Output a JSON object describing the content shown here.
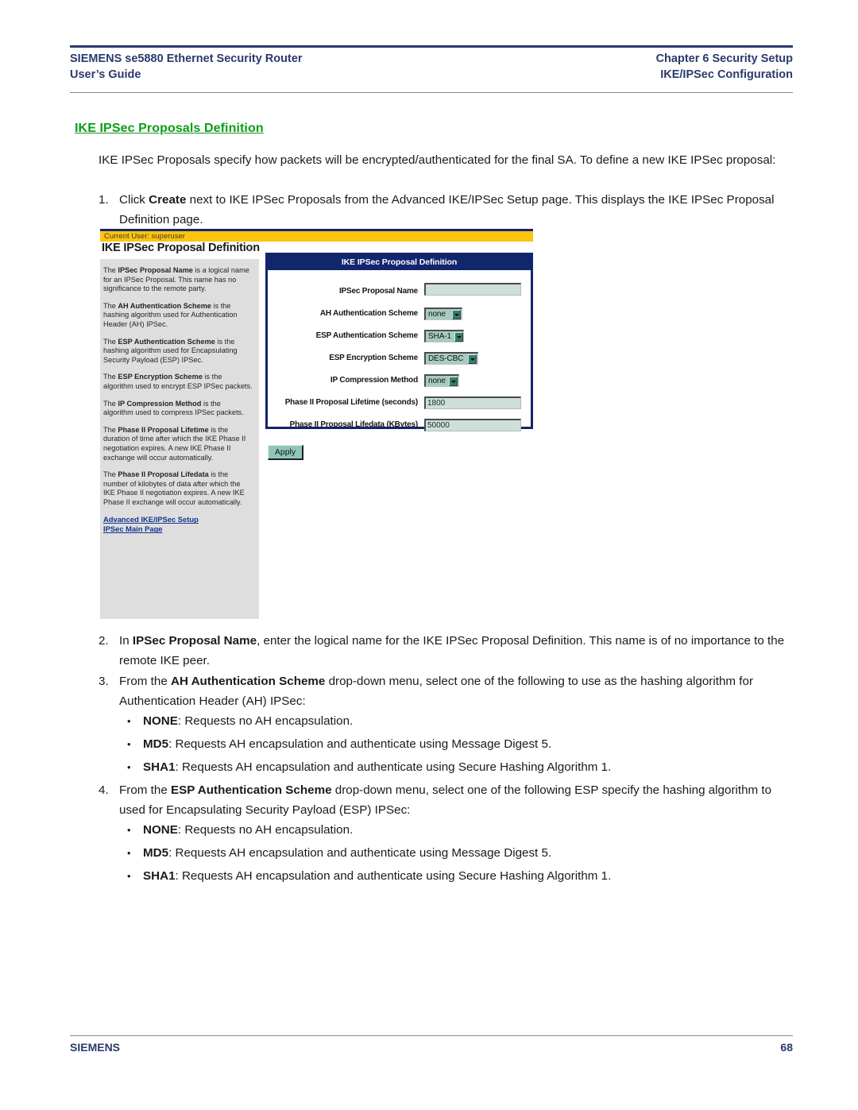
{
  "header": {
    "left_line1": "SIEMENS se5880 Ethernet Security Router",
    "left_line2": "User’s Guide",
    "right_line1": "Chapter 6  Security Setup",
    "right_line2": "IKE/IPSec Configuration"
  },
  "section": {
    "heading": "IKE IPSec Proposals Definition",
    "intro": "IKE IPSec Proposals specify how packets will be encrypted/authenticated for the final SA. To define a new IKE IPSec proposal:"
  },
  "steps": [
    {
      "num": "1.",
      "parts": [
        {
          "t": "Click ",
          "b": false
        },
        {
          "t": "Create",
          "b": true
        },
        {
          "t": " next to IKE IPSec Proposals from the Advanced IKE/IPSec Setup page. This displays the IKE IPSec Proposal Definition page.",
          "b": false
        }
      ]
    },
    {
      "num": "2.",
      "parts": [
        {
          "t": "In ",
          "b": false
        },
        {
          "t": "IPSec Proposal Name",
          "b": true
        },
        {
          "t": ", enter the logical name for the IKE IPSec Proposal Definition. This name is of no importance to the remote IKE peer.",
          "b": false
        }
      ]
    },
    {
      "num": "3.",
      "parts": [
        {
          "t": "From the ",
          "b": false
        },
        {
          "t": "AH Authentication Scheme",
          "b": true
        },
        {
          "t": " drop-down menu, select one of the following to use as the hashing algorithm for Authentication Header (AH) IPSec:",
          "b": false
        }
      ]
    },
    {
      "num": "4.",
      "parts": [
        {
          "t": "From the ",
          "b": false
        },
        {
          "t": "ESP Authentication Scheme",
          "b": true
        },
        {
          "t": " drop-down menu, select one of the following ESP specify the hashing algorithm to used for Encapsulating Security Payload (ESP) IPSec:",
          "b": false
        }
      ]
    }
  ],
  "bullets_ah": [
    {
      "term": "NONE",
      "rest": ": Requests no AH encapsulation."
    },
    {
      "term": "MD5",
      "rest": ": Requests AH encapsulation and authenticate using Message Digest 5."
    },
    {
      "term": "SHA1",
      "rest": ": Requests AH encapsulation and authenticate using Secure Hashing Algorithm 1."
    }
  ],
  "bullets_esp": [
    {
      "term": "NONE",
      "rest": ": Requests no AH encapsulation."
    },
    {
      "term": "MD5",
      "rest": ": Requests AH encapsulation and authenticate using Message Digest 5."
    },
    {
      "term": "SHA1",
      "rest": ": Requests AH encapsulation and authenticate using Secure Hashing Algorithm 1."
    }
  ],
  "screenshot": {
    "user_bar": "Current User: superuser",
    "panel_title": "IKE IPSec Proposal Definition",
    "help": {
      "p1_lead": "The ",
      "p1_term": "IPSec Proposal Name",
      "p1_rest": " is a logical name for an IPSec Proposal. This name has no significance to the remote party.",
      "p2_term": "AH Authentication Scheme",
      "p2_rest": " is the hashing algorithm used for Authentication Header (AH) IPSec.",
      "p3_term": "ESP Authentication Scheme",
      "p3_rest": " is the hashing algorithm used for Encapsulating Security Payload (ESP) IPSec.",
      "p4_term": "ESP Encryption Scheme",
      "p4_rest": " is the algorithm used to encrypt ESP IPSec packets.",
      "p5_term": "IP Compression Method",
      "p5_rest": " is the algorithm used to compress IPSec packets.",
      "p6_term": "Phase II Proposal Lifetime",
      "p6_rest": " is the duration of time after which the IKE Phase II negotiation expires. A new IKE Phase II exchange will occur automatically.",
      "p7_term": "Phase II Proposal Lifedata",
      "p7_rest": " is the number of kilobytes of data after which the IKE Phase II negotiation expires. A new IKE Phase II exchange will occur automatically."
    },
    "links": [
      "Advanced IKE/IPSec Setup",
      "IPSec Main Page"
    ],
    "form": {
      "title": "IKE IPSec Proposal Definition",
      "fields": [
        {
          "label": "IPSec Proposal Name",
          "type": "text",
          "value": ""
        },
        {
          "label": "AH Authentication Scheme",
          "type": "select",
          "value": "none"
        },
        {
          "label": "ESP Authentication Scheme",
          "type": "select",
          "value": "SHA-1"
        },
        {
          "label": "ESP Encryption Scheme",
          "type": "select",
          "value": "DES-CBC"
        },
        {
          "label": "IP Compression Method",
          "type": "select",
          "value": "none"
        },
        {
          "label": "Phase II Proposal Lifetime (seconds)",
          "type": "text",
          "value": "1800"
        },
        {
          "label": "Phase II Proposal Lifedata (KBytes)",
          "type": "text",
          "value": "50000"
        }
      ],
      "apply_label": "Apply"
    }
  },
  "footer": {
    "brand": "SIEMENS",
    "page_number": "68"
  },
  "colors": {
    "header_blue": "#2b3a6b",
    "heading_green": "#0e9c18",
    "panel_blue": "#12266e",
    "user_bar_yellow": "#fec40d",
    "sidebar_gray": "#dedede",
    "field_teal": "#cfdfd8",
    "select_teal": "#a6ccc2",
    "link_blue": "#13348f"
  }
}
